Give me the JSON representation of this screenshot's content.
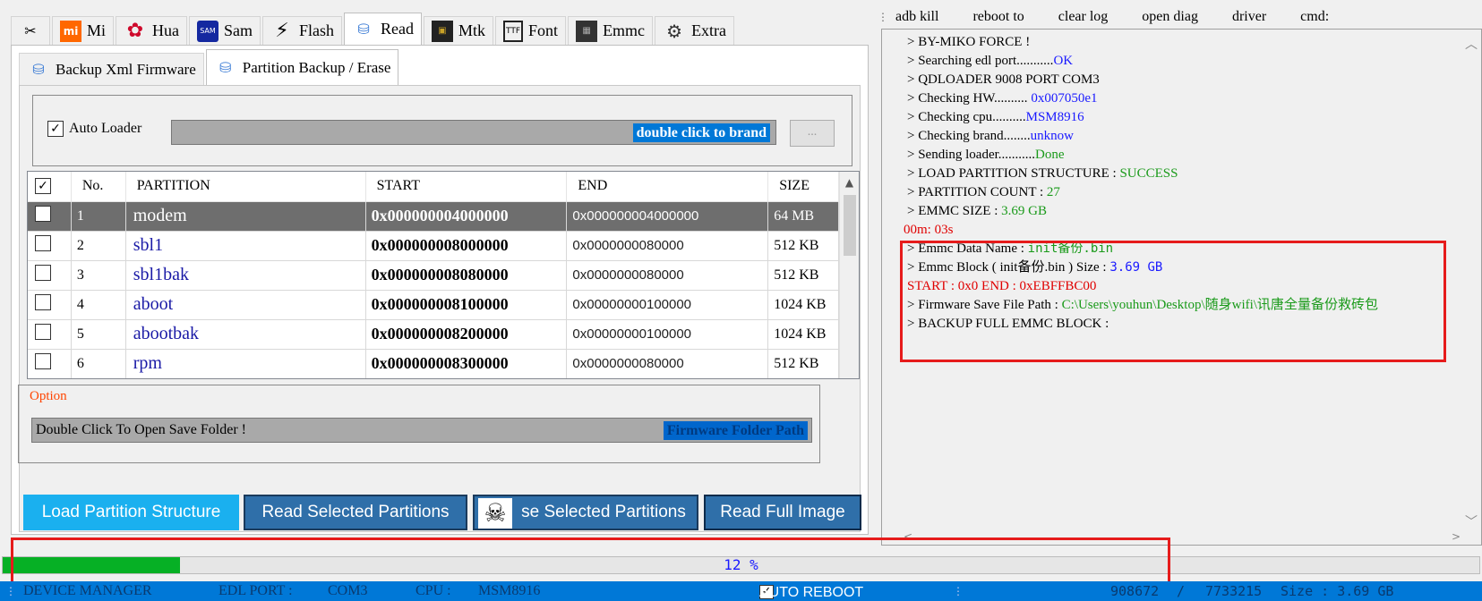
{
  "top_tabs": [
    {
      "label": "",
      "icon": "tools-icon"
    },
    {
      "label": "Mi",
      "icon": "mi-logo-icon"
    },
    {
      "label": "Hua",
      "icon": "huawei-logo-icon"
    },
    {
      "label": "Sam",
      "icon": "samsung-logo-icon"
    },
    {
      "label": "Flash",
      "icon": "lightning-icon"
    },
    {
      "label": "Read",
      "icon": "network-icon"
    },
    {
      "label": "Mtk",
      "icon": "chip-icon"
    },
    {
      "label": "Font",
      "icon": "font-file-icon"
    },
    {
      "label": "Emmc",
      "icon": "emmc-chip-icon"
    },
    {
      "label": "Extra",
      "icon": "gear-icon"
    }
  ],
  "sub_tabs": [
    {
      "label": "Backup Xml Firmware"
    },
    {
      "label": "Partition Backup / Erase"
    }
  ],
  "loader": {
    "auto_loader_label": "Auto Loader",
    "auto_loader_checked": true,
    "field_hint": "double click to brand",
    "browse_label": "..."
  },
  "table": {
    "columns": [
      "",
      "No.",
      "PARTITION",
      "START",
      "END",
      "SIZE"
    ],
    "rows": [
      {
        "no": "1",
        "partition": "modem",
        "start": "0x000000004000000",
        "end": "0x000000004000000",
        "size": "64 MB",
        "selected": true
      },
      {
        "no": "2",
        "partition": "sbl1",
        "start": "0x000000008000000",
        "end": "0x0000000080000",
        "size": "512 KB",
        "selected": false
      },
      {
        "no": "3",
        "partition": "sbl1bak",
        "start": "0x000000008080000",
        "end": "0x0000000080000",
        "size": "512 KB",
        "selected": false
      },
      {
        "no": "4",
        "partition": "aboot",
        "start": "0x000000008100000",
        "end": "0x00000000100000",
        "size": "1024 KB",
        "selected": false
      },
      {
        "no": "5",
        "partition": "abootbak",
        "start": "0x000000008200000",
        "end": "0x00000000100000",
        "size": "1024 KB",
        "selected": false
      },
      {
        "no": "6",
        "partition": "rpm",
        "start": "0x000000008300000",
        "end": "0x0000000080000",
        "size": "512 KB",
        "selected": false
      }
    ]
  },
  "option": {
    "label": "Option",
    "folder_text": "Double Click To Open Save Folder !",
    "folder_hint": "Firmware Folder Path"
  },
  "buttons": {
    "load": "Load Partition Structure",
    "read": "Read Selected Partitions",
    "erase": "se Selected Partitions",
    "full": "Read Full Image"
  },
  "right_toolbar": [
    "adb kill",
    "reboot to",
    "clear log",
    "open diag",
    "driver",
    "cmd:"
  ],
  "log": {
    "l1": "> BY-MIKO FORCE !",
    "l2a": "> Searching edl port...........",
    "l2b": "OK",
    "l3": "> QDLOADER 9008 PORT COM3",
    "l4a": "> Checking HW.......... ",
    "l4b": "0x007050e1",
    "l5a": "> Checking cpu..........",
    "l5b": "MSM8916",
    "l6a": "> Checking brand........",
    "l6b": "unknow",
    "l7a": "> Sending loader...........",
    "l7b": "Done",
    "l8a": "> LOAD PARTITION  STRUCTURE  :  ",
    "l8b": "SUCCESS",
    "l9a": "> PARTITION COUNT  : ",
    "l9b": "27",
    "l10a": "> EMMC SIZE   : ",
    "l10b": "3.69 GB",
    "l11": "00m: 03s",
    "l12a": "> Emmc Data Name  :  ",
    "l12b": "init备份.bin",
    "l13a": "> Emmc Block ( init备份.bin ) Size    :    ",
    "l13b": "3.69 GB",
    "l14": " START  :  0x0    END :   0xEBFFBC00",
    "l15a": "> Firmware Save File  Path : ",
    "l15b": "C:\\Users\\youhun\\Desktop\\随身wifi\\讯唐全量备份救砖包",
    "l16": "> BACKUP FULL EMMC BLOCK   :"
  },
  "progress": {
    "value": 0.12,
    "text": "12 %"
  },
  "status": {
    "device_manager": "DEVICE MANAGER",
    "edl_port_label": "EDL PORT :",
    "edl_port_value": "COM3",
    "cpu_label": "CPU :",
    "cpu_value": "MSM8916",
    "auto_reboot": "AUTO REBOOT",
    "bytes_done": "908672",
    "separator": "/",
    "bytes_total": "7733215",
    "size_label": "Size : 3.69 GB"
  },
  "colors": {
    "accent": "#0078d7",
    "progress_fill": "#06b025",
    "highlight": "#e61b1b"
  }
}
